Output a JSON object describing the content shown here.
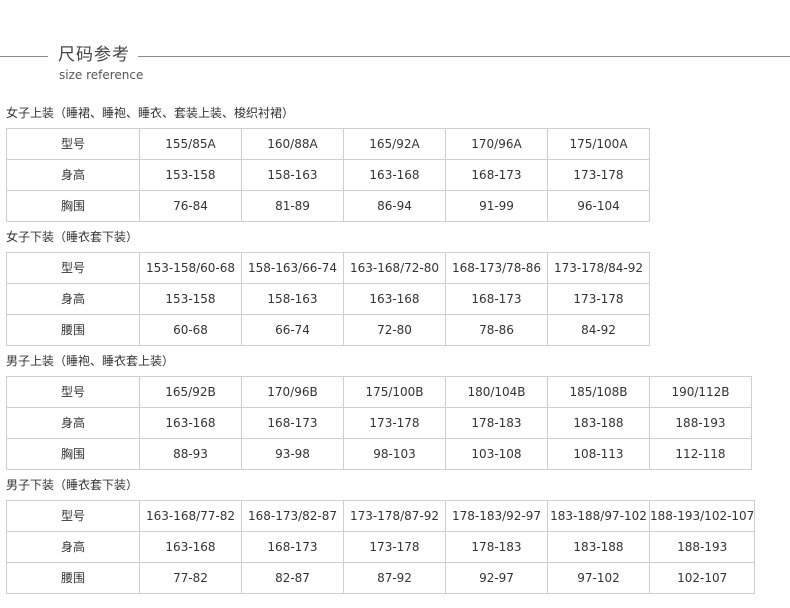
{
  "header": {
    "title": "尺码参考",
    "subtitle": "size reference"
  },
  "sections": [
    {
      "title": "女子上装（睡裙、睡袍、睡衣、套装上装、梭织衬裙）",
      "rows": [
        {
          "label": "型号",
          "cells": [
            "155/85A",
            "160/88A",
            "165/92A",
            "170/96A",
            "175/100A"
          ]
        },
        {
          "label": "身高",
          "cells": [
            "153-158",
            "158-163",
            "163-168",
            "168-173",
            "173-178"
          ]
        },
        {
          "label": "胸围",
          "cells": [
            "76-84",
            "81-89",
            "86-94",
            "91-99",
            "96-104"
          ]
        }
      ]
    },
    {
      "title": "女子下装（睡衣套下装）",
      "rows": [
        {
          "label": "型号",
          "cells": [
            "153-158/60-68",
            "158-163/66-74",
            "163-168/72-80",
            "168-173/78-86",
            "173-178/84-92"
          ]
        },
        {
          "label": "身高",
          "cells": [
            "153-158",
            "158-163",
            "163-168",
            "168-173",
            "173-178"
          ]
        },
        {
          "label": "腰围",
          "cells": [
            "60-68",
            "66-74",
            "72-80",
            "78-86",
            "84-92"
          ]
        }
      ]
    },
    {
      "title": "男子上装（睡袍、睡衣套上装）",
      "rows": [
        {
          "label": "型号",
          "cells": [
            "165/92B",
            "170/96B",
            "175/100B",
            "180/104B",
            "185/108B",
            "190/112B"
          ]
        },
        {
          "label": "身高",
          "cells": [
            "163-168",
            "168-173",
            "173-178",
            "178-183",
            "183-188",
            "188-193"
          ]
        },
        {
          "label": "胸围",
          "cells": [
            "88-93",
            "93-98",
            "98-103",
            "103-108",
            "108-113",
            "112-118"
          ]
        }
      ]
    },
    {
      "title": "男子下装（睡衣套下装）",
      "rows": [
        {
          "label": "型号",
          "cells": [
            "163-168/77-82",
            "168-173/82-87",
            "173-178/87-92",
            "178-183/92-97",
            "183-188/97-102",
            "188-193/102-107"
          ]
        },
        {
          "label": "身高",
          "cells": [
            "163-168",
            "168-173",
            "173-178",
            "178-183",
            "183-188",
            "188-193"
          ]
        },
        {
          "label": "腰围",
          "cells": [
            "77-82",
            "82-87",
            "87-92",
            "92-97",
            "97-102",
            "102-107"
          ]
        }
      ]
    }
  ]
}
